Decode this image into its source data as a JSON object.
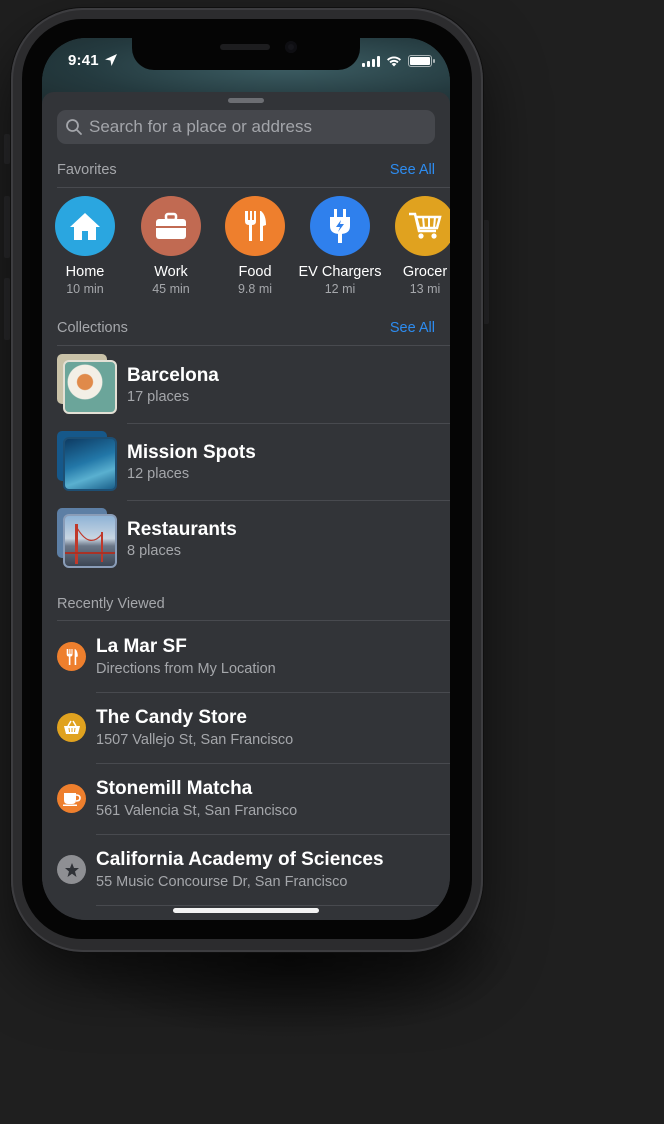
{
  "status_bar": {
    "time": "9:41",
    "location_icon": "location-arrow-icon",
    "signal_icon": "cellular-signal-icon",
    "wifi_icon": "wifi-icon",
    "battery_icon": "battery-icon"
  },
  "search": {
    "placeholder": "Search for a place or address",
    "icon": "search-icon"
  },
  "favorites": {
    "title": "Favorites",
    "see_all": "See All",
    "items": [
      {
        "label": "Home",
        "sub": "10 min",
        "icon": "house-icon",
        "color": "#2aa6e0"
      },
      {
        "label": "Work",
        "sub": "45 min",
        "icon": "briefcase-icon",
        "color": "#c16a52"
      },
      {
        "label": "Food",
        "sub": "9.8 mi",
        "icon": "fork-knife-icon",
        "color": "#ee7f2d"
      },
      {
        "label": "EV Chargers",
        "sub": "12 mi",
        "icon": "ev-plug-icon",
        "color": "#2f80ed"
      },
      {
        "label": "Grocer",
        "sub": "13 mi",
        "icon": "shopping-cart-icon",
        "color": "#e0a21f"
      }
    ]
  },
  "collections": {
    "title": "Collections",
    "see_all": "See All",
    "items": [
      {
        "title": "Barcelona",
        "sub": "17 places"
      },
      {
        "title": "Mission Spots",
        "sub": "12 places"
      },
      {
        "title": "Restaurants",
        "sub": "8 places"
      }
    ]
  },
  "recent": {
    "title": "Recently Viewed",
    "items": [
      {
        "title": "La Mar SF",
        "sub": "Directions from My Location",
        "icon": "fork-knife-icon",
        "color": "#ee7f2d"
      },
      {
        "title": "The Candy Store",
        "sub": "1507 Vallejo St, San Francisco",
        "icon": "basket-icon",
        "color": "#e0a21f"
      },
      {
        "title": "Stonemill Matcha",
        "sub": "561 Valencia St, San Francisco",
        "icon": "coffee-cup-icon",
        "color": "#ee7f2d"
      },
      {
        "title": "California Academy of Sciences",
        "sub": "55 Music Concourse Dr, San Francisco",
        "icon": "star-icon",
        "color": "#8e8f93"
      }
    ]
  }
}
